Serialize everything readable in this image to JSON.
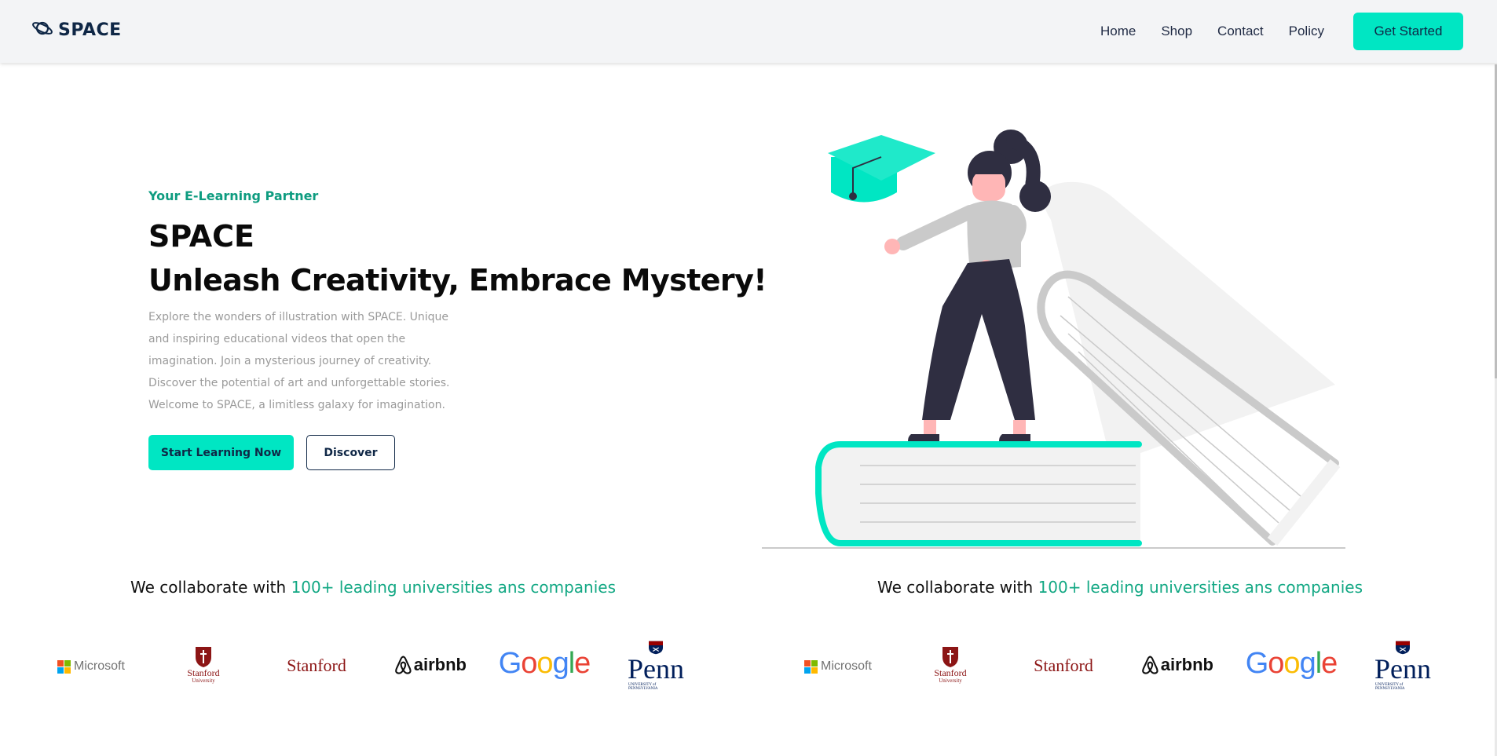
{
  "brand": {
    "name": "SPACE"
  },
  "nav": {
    "links": [
      "Home",
      "Shop",
      "Contact",
      "Policy"
    ],
    "cta": "Get Started"
  },
  "hero": {
    "eyebrow": "Your E-Learning Partner",
    "title_line1": "SPACE",
    "title_line2": "Unleash Creativity, Embrace Mystery!",
    "description": "Explore the wonders of illustration with SPACE. Unique and inspiring educational videos that open the imagination. Join a mysterious journey of creativity. Discover the potential of art and unforgettable stories. Welcome to SPACE, a limitless galaxy for imagination.",
    "primary_button": "Start Learning Now",
    "secondary_button": "Discover"
  },
  "collab": [
    {
      "prefix": "We collaborate with ",
      "accent": "100+ leading universities ans companies",
      "logos": {
        "microsoft": "Microsoft",
        "stanford_university_line1": "Stanford",
        "stanford_university_line2": "University",
        "stanford": "Stanford",
        "airbnb": "airbnb",
        "google": "Google",
        "penn": "Penn",
        "penn_sub": "UNIVERSITY of PENNSYLVANIA"
      }
    },
    {
      "prefix": "We collaborate with ",
      "accent": "100+ leading universities ans companies",
      "logos": {
        "microsoft": "Microsoft",
        "stanford_university_line1": "Stanford",
        "stanford_university_line2": "University",
        "stanford": "Stanford",
        "airbnb": "airbnb",
        "google": "Google",
        "penn": "Penn",
        "penn_sub": "UNIVERSITY of PENNSYLVANIA"
      }
    }
  ],
  "colors": {
    "accent": "#00e6c3",
    "navy": "#0f2746",
    "eyebrow_green": "#0e9c80",
    "figure_dark": "#2f2e41",
    "skin": "#ffb6b6",
    "book_gray": "#cacaca",
    "page_white": "#f2f2f2"
  },
  "icons": {
    "brand": "planet-icon"
  }
}
